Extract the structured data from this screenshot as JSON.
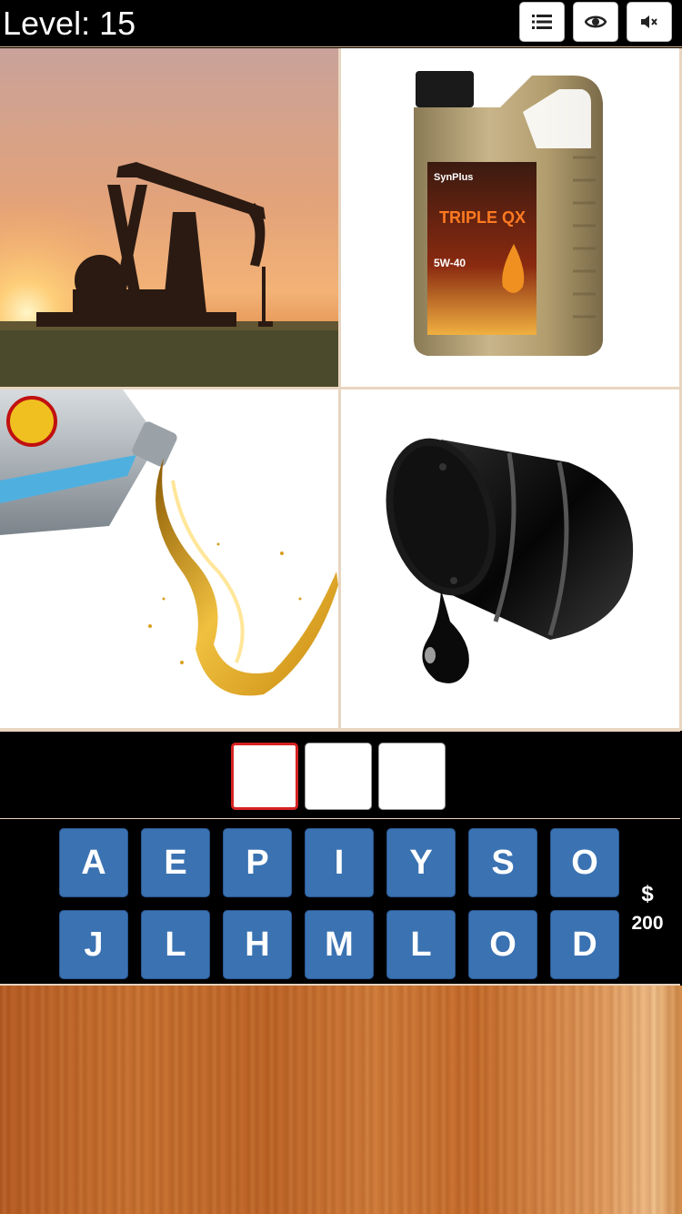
{
  "header": {
    "level_label": "Level: 15",
    "buttons": [
      {
        "icon": "list-icon"
      },
      {
        "icon": "eye-icon"
      },
      {
        "icon": "mute-icon"
      }
    ]
  },
  "pictures": [
    {
      "icon": "oil-pumpjack-sunset-image"
    },
    {
      "icon": "motor-oil-bottle-image",
      "brand_text": "SynPlus",
      "product_text": "TRIPLE QX",
      "grade_text": "5W-40"
    },
    {
      "icon": "oil-pouring-image"
    },
    {
      "icon": "oil-barrel-drip-image"
    }
  ],
  "answer": {
    "slots": [
      "",
      "",
      ""
    ],
    "active_index": 0
  },
  "keyboard": {
    "rows": [
      [
        "A",
        "E",
        "P",
        "I",
        "Y",
        "S",
        "O"
      ],
      [
        "J",
        "L",
        "H",
        "M",
        "L",
        "O",
        "D"
      ]
    ]
  },
  "coins": {
    "symbol": "$",
    "amount": "200"
  },
  "colors": {
    "key_blue": "#3a72b2",
    "active_slot_border": "#d62222",
    "background_wood": "#c46a2a"
  }
}
